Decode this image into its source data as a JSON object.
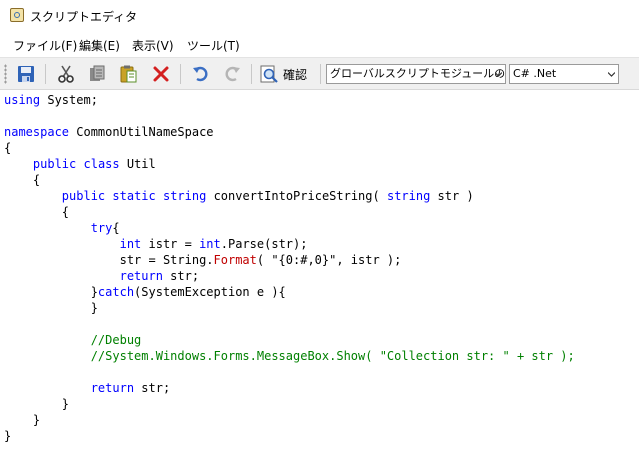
{
  "window": {
    "title": "スクリプトエディタ"
  },
  "menu": {
    "items": [
      {
        "label": "ファイル(F)"
      },
      {
        "label": "編集(E)"
      },
      {
        "label": "表示(V)"
      },
      {
        "label": "ツール(T)"
      }
    ]
  },
  "toolbar": {
    "confirm_label": "確認",
    "module_select": {
      "value": "グローバルスクリプトモジュールのエ"
    },
    "language_select": {
      "value": "C# .Net"
    }
  },
  "colors": {
    "keyword": "#0000ff",
    "method": "#c00000",
    "comment": "#008000"
  },
  "code": {
    "lines": [
      [
        {
          "t": "using",
          "k": "kw"
        },
        {
          "t": " System;"
        }
      ],
      [],
      [
        {
          "t": "namespace",
          "k": "kw"
        },
        {
          "t": " CommonUtilNameSpace"
        }
      ],
      [
        {
          "t": "{"
        }
      ],
      [
        {
          "t": "    "
        },
        {
          "t": "public",
          "k": "kw"
        },
        {
          "t": " "
        },
        {
          "t": "class",
          "k": "kw"
        },
        {
          "t": " Util"
        }
      ],
      [
        {
          "t": "    {"
        }
      ],
      [
        {
          "t": "        "
        },
        {
          "t": "public",
          "k": "kw"
        },
        {
          "t": " "
        },
        {
          "t": "static",
          "k": "kw"
        },
        {
          "t": " "
        },
        {
          "t": "string",
          "k": "kw"
        },
        {
          "t": " convertIntoPriceString( "
        },
        {
          "t": "string",
          "k": "kw"
        },
        {
          "t": " str )"
        }
      ],
      [
        {
          "t": "        {"
        }
      ],
      [
        {
          "t": "            "
        },
        {
          "t": "try",
          "k": "kw"
        },
        {
          "t": "{"
        }
      ],
      [
        {
          "t": "                "
        },
        {
          "t": "int",
          "k": "kw"
        },
        {
          "t": " istr = "
        },
        {
          "t": "int",
          "k": "kw"
        },
        {
          "t": ".Parse(str);"
        }
      ],
      [
        {
          "t": "                str = String."
        },
        {
          "t": "Format",
          "k": "mth"
        },
        {
          "t": "( \"{0:#,0}\", istr );"
        }
      ],
      [
        {
          "t": "                "
        },
        {
          "t": "return",
          "k": "kw"
        },
        {
          "t": " str;"
        }
      ],
      [
        {
          "t": "            }"
        },
        {
          "t": "catch",
          "k": "kw"
        },
        {
          "t": "(SystemException e ){"
        }
      ],
      [
        {
          "t": "            }"
        }
      ],
      [],
      [
        {
          "t": "            "
        },
        {
          "t": "//Debug",
          "k": "cm"
        }
      ],
      [
        {
          "t": "            "
        },
        {
          "t": "//System.Windows.Forms.MessageBox.Show( \"Collection str: \" + str );",
          "k": "cm"
        }
      ],
      [],
      [
        {
          "t": "            "
        },
        {
          "t": "return",
          "k": "kw"
        },
        {
          "t": " str;"
        }
      ],
      [
        {
          "t": "        }"
        }
      ],
      [
        {
          "t": "    }"
        }
      ],
      [
        {
          "t": "}"
        }
      ]
    ]
  }
}
